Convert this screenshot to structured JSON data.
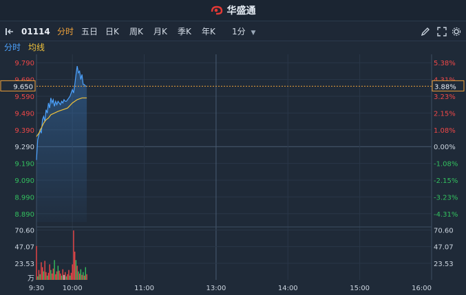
{
  "brand": {
    "name": "华盛通"
  },
  "toolbar": {
    "code": "01114",
    "tabs": [
      "分时",
      "五日",
      "日K",
      "周K",
      "月K",
      "季K",
      "年K"
    ],
    "active_tab": "分时",
    "interval": "1分",
    "icons": [
      "collapse-left-icon",
      "pen-icon",
      "expand-icon",
      "settings-icon"
    ]
  },
  "subtabs": {
    "minute": "分时",
    "avg": "均线"
  },
  "colors": {
    "price_line": "#4da3ff",
    "avg_line": "#f2c33b",
    "up": "#f04848",
    "down": "#33c05f",
    "neutral": "#cdd6e0",
    "accent": "#f0a23a"
  },
  "chart_data": {
    "type": "line",
    "reference_price": 9.29,
    "current_price": 9.65,
    "current_change": "3.88%",
    "price_ticks": [
      "9.790",
      "9.690",
      "9.590",
      "9.490",
      "9.390",
      "9.290",
      "9.190",
      "9.090",
      "8.990",
      "8.890"
    ],
    "price_tick_values": [
      9.79,
      9.69,
      9.59,
      9.49,
      9.39,
      9.29,
      9.19,
      9.09,
      8.99,
      8.89
    ],
    "pct_ticks": [
      "5.38%",
      "4.31%",
      "3.23%",
      "2.15%",
      "1.08%",
      "0.00%",
      "-1.08%",
      "-2.15%",
      "-3.23%",
      "-4.31%"
    ],
    "volume_ticks": [
      "70.60",
      "47.07",
      "23.53"
    ],
    "volume_tick_values": [
      70.6,
      47.07,
      23.53
    ],
    "volume_unit": "万",
    "x_ticks": [
      "9:30",
      "10:00",
      "11:00",
      "13:00",
      "14:00",
      "15:00",
      "16:00"
    ],
    "x_tick_minutes": [
      0,
      30,
      90,
      150,
      210,
      270,
      330
    ],
    "price_series": [
      {
        "m": 0,
        "v": 9.21
      },
      {
        "m": 1,
        "v": 9.33
      },
      {
        "m": 2,
        "v": 9.36
      },
      {
        "m": 3,
        "v": 9.39
      },
      {
        "m": 4,
        "v": 9.37
      },
      {
        "m": 5,
        "v": 9.45
      },
      {
        "m": 6,
        "v": 9.47
      },
      {
        "m": 7,
        "v": 9.44
      },
      {
        "m": 8,
        "v": 9.51
      },
      {
        "m": 9,
        "v": 9.49
      },
      {
        "m": 10,
        "v": 9.55
      },
      {
        "m": 11,
        "v": 9.52
      },
      {
        "m": 12,
        "v": 9.58
      },
      {
        "m": 13,
        "v": 9.55
      },
      {
        "m": 14,
        "v": 9.57
      },
      {
        "m": 15,
        "v": 9.53
      },
      {
        "m": 16,
        "v": 9.56
      },
      {
        "m": 17,
        "v": 9.54
      },
      {
        "m": 18,
        "v": 9.56
      },
      {
        "m": 19,
        "v": 9.55
      },
      {
        "m": 20,
        "v": 9.54
      },
      {
        "m": 21,
        "v": 9.56
      },
      {
        "m": 22,
        "v": 9.55
      },
      {
        "m": 23,
        "v": 9.57
      },
      {
        "m": 24,
        "v": 9.56
      },
      {
        "m": 25,
        "v": 9.56
      },
      {
        "m": 26,
        "v": 9.57
      },
      {
        "m": 27,
        "v": 9.58
      },
      {
        "m": 28,
        "v": 9.59
      },
      {
        "m": 29,
        "v": 9.61
      },
      {
        "m": 30,
        "v": 9.63
      },
      {
        "m": 31,
        "v": 9.61
      },
      {
        "m": 32,
        "v": 9.66
      },
      {
        "m": 33,
        "v": 9.72
      },
      {
        "m": 34,
        "v": 9.77
      },
      {
        "m": 35,
        "v": 9.73
      },
      {
        "m": 36,
        "v": 9.74
      },
      {
        "m": 37,
        "v": 9.69
      },
      {
        "m": 38,
        "v": 9.72
      },
      {
        "m": 39,
        "v": 9.66
      },
      {
        "m": 40,
        "v": 9.66
      },
      {
        "m": 41,
        "v": 9.65
      },
      {
        "m": 42,
        "v": 9.65
      }
    ],
    "avg_series": [
      {
        "m": 0,
        "v": 9.35
      },
      {
        "m": 2,
        "v": 9.37
      },
      {
        "m": 4,
        "v": 9.4
      },
      {
        "m": 6,
        "v": 9.43
      },
      {
        "m": 8,
        "v": 9.45
      },
      {
        "m": 10,
        "v": 9.46
      },
      {
        "m": 12,
        "v": 9.48
      },
      {
        "m": 15,
        "v": 9.49
      },
      {
        "m": 18,
        "v": 9.5
      },
      {
        "m": 22,
        "v": 9.51
      },
      {
        "m": 26,
        "v": 9.52
      },
      {
        "m": 30,
        "v": 9.55
      },
      {
        "m": 34,
        "v": 9.57
      },
      {
        "m": 38,
        "v": 9.58
      },
      {
        "m": 42,
        "v": 9.58
      }
    ],
    "volume_series": [
      {
        "m": 0,
        "v": 48,
        "c": "up"
      },
      {
        "m": 1,
        "v": 5,
        "c": "down"
      },
      {
        "m": 2,
        "v": 14,
        "c": "up"
      },
      {
        "m": 3,
        "v": 8,
        "c": "down"
      },
      {
        "m": 4,
        "v": 25,
        "c": "up"
      },
      {
        "m": 5,
        "v": 18,
        "c": "up"
      },
      {
        "m": 6,
        "v": 12,
        "c": "down"
      },
      {
        "m": 7,
        "v": 27,
        "c": "up"
      },
      {
        "m": 8,
        "v": 11,
        "c": "up"
      },
      {
        "m": 9,
        "v": 6,
        "c": "down"
      },
      {
        "m": 10,
        "v": 10,
        "c": "up"
      },
      {
        "m": 11,
        "v": 22,
        "c": "up"
      },
      {
        "m": 12,
        "v": 14,
        "c": "down"
      },
      {
        "m": 13,
        "v": 9,
        "c": "up"
      },
      {
        "m": 14,
        "v": 16,
        "c": "up"
      },
      {
        "m": 15,
        "v": 28,
        "c": "down"
      },
      {
        "m": 16,
        "v": 8,
        "c": "up"
      },
      {
        "m": 17,
        "v": 12,
        "c": "up"
      },
      {
        "m": 18,
        "v": 20,
        "c": "down"
      },
      {
        "m": 19,
        "v": 13,
        "c": "up"
      },
      {
        "m": 20,
        "v": 9,
        "c": "up"
      },
      {
        "m": 21,
        "v": 6,
        "c": "down"
      },
      {
        "m": 22,
        "v": 15,
        "c": "up"
      },
      {
        "m": 23,
        "v": 7,
        "c": "neutral"
      },
      {
        "m": 24,
        "v": 11,
        "c": "up"
      },
      {
        "m": 25,
        "v": 5,
        "c": "down"
      },
      {
        "m": 26,
        "v": 8,
        "c": "up"
      },
      {
        "m": 27,
        "v": 14,
        "c": "up"
      },
      {
        "m": 28,
        "v": 6,
        "c": "down"
      },
      {
        "m": 29,
        "v": 10,
        "c": "up"
      },
      {
        "m": 30,
        "v": 22,
        "c": "up"
      },
      {
        "m": 31,
        "v": 70,
        "c": "up"
      },
      {
        "m": 32,
        "v": 40,
        "c": "up"
      },
      {
        "m": 33,
        "v": 28,
        "c": "down"
      },
      {
        "m": 34,
        "v": 20,
        "c": "up"
      },
      {
        "m": 35,
        "v": 12,
        "c": "down"
      },
      {
        "m": 36,
        "v": 9,
        "c": "up"
      },
      {
        "m": 37,
        "v": 15,
        "c": "down"
      },
      {
        "m": 38,
        "v": 7,
        "c": "up"
      },
      {
        "m": 39,
        "v": 11,
        "c": "down"
      },
      {
        "m": 40,
        "v": 6,
        "c": "up"
      },
      {
        "m": 41,
        "v": 18,
        "c": "down"
      },
      {
        "m": 42,
        "v": 8,
        "c": "up"
      }
    ]
  }
}
